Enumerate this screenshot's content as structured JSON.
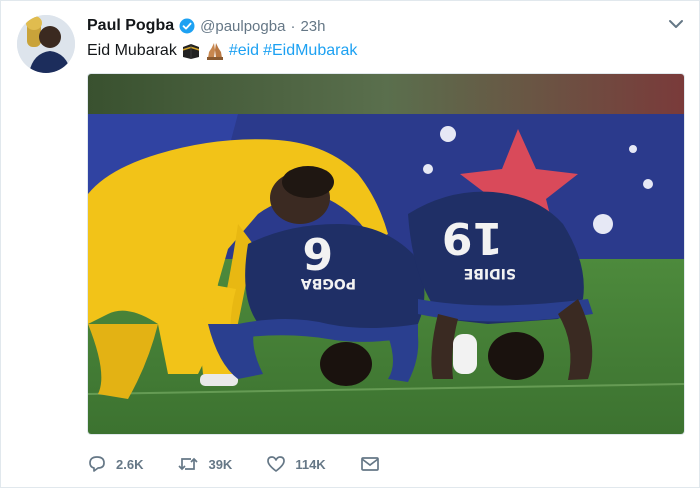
{
  "tweet": {
    "author_name": "Paul Pogba",
    "handle": "@paulpogba",
    "separator": "·",
    "time": "23h",
    "text_plain": "Eid Mubarak",
    "hashtags": [
      "#eid",
      "#EidMubarak"
    ],
    "emojis": [
      "kaaba-emoji",
      "praying-hands-emoji"
    ],
    "verified_icon": "verified-badge-icon",
    "menu_icon": "chevron-down-icon"
  },
  "media": {
    "jersey_numbers": [
      "6",
      "19"
    ],
    "jersey_names": [
      "POGBA",
      "SIDIBE"
    ]
  },
  "actions": {
    "reply": {
      "icon": "reply-icon",
      "count": "2.6K"
    },
    "retweet": {
      "icon": "retweet-icon",
      "count": "39K"
    },
    "like": {
      "icon": "heart-icon",
      "count": "114K"
    },
    "message": {
      "icon": "envelope-icon"
    }
  },
  "colors": {
    "link": "#1da1f2",
    "secondary_text": "#657786",
    "border": "#e1e8ed"
  }
}
